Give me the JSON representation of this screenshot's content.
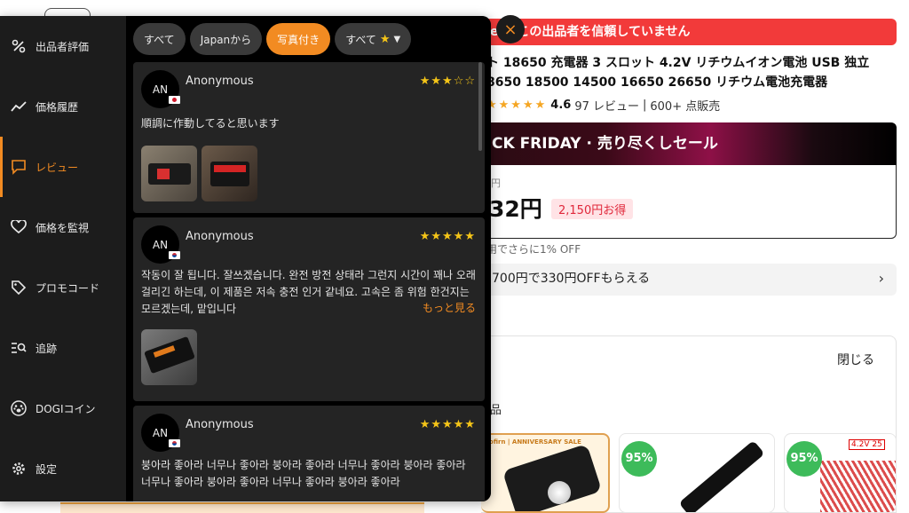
{
  "background": {
    "trust_banner": "erはこの出品者を信頼していません",
    "title_line1": "ト 18650 充電器 3 スロット 4.2V リチウムイオン電池 USB 独立",
    "title_line2": "8650 18500 14500 16650 26650 リチウム電池充電器",
    "rating_score": "4.6",
    "rating_reviews": "97 レビュー",
    "rating_sold": "600+ 点販売",
    "rating_separator": "|",
    "stars_display": "★★★★★",
    "sale_banner": "CK FRIDAY · 売り尽くしセール",
    "old_price_fragment": "円",
    "price_now": "32円",
    "price_save": "2,150円お得",
    "discount_note": "用でさらに1% OFF",
    "coupon_text": "700円で330円OFFもらえる",
    "coupon_chevron": "›",
    "close_label": "閉じる",
    "section_label": "品",
    "card1_tag": "Sofirn | ANNIVERSARY SALE",
    "card2_badge": "95%",
    "card3_badge": "95%",
    "card3_tag": "4.2V 25"
  },
  "extension": {
    "close_icon": "×",
    "sidebar": [
      {
        "label": "出品者評価",
        "icon": "percent-icon"
      },
      {
        "label": "価格履歴",
        "icon": "trend-line-icon"
      },
      {
        "label": "レビュー",
        "icon": "comment-icon",
        "active": true
      },
      {
        "label": "価格を監視",
        "icon": "heart-icon"
      },
      {
        "label": "プロモコード",
        "icon": "tag-icon"
      },
      {
        "label": "追跡",
        "icon": "track-icon"
      },
      {
        "label": "DOGIコイン",
        "icon": "paw-icon"
      },
      {
        "label": "設定",
        "icon": "gear-icon"
      }
    ],
    "filters": {
      "all": "すべて",
      "from_japan": "Japanから",
      "with_photos": "写真付き",
      "stars_all": "すべて",
      "star_icon": "★",
      "caret": "▼"
    },
    "reviews": [
      {
        "avatar": "AN",
        "name": "Anonymous",
        "stars": 3,
        "star_string_on": "★★★",
        "star_string_off": "☆☆",
        "text": "順調に作動してると思います",
        "flag": "jp"
      },
      {
        "avatar": "AN",
        "name": "Anonymous",
        "stars": 5,
        "star_string_on": "★★★★★",
        "star_string_off": "",
        "text": "작동이 잘 됩니다. 잘쓰겠습니다. 완전 방전 상태라 그런지 시간이 꽤나 오래 걸리긴 하는데, 이 제품은 저속 충전 인거 같네요. 고속은 좀 위험 한건지는 모르겠는데, 맡입니다",
        "more": "もっと見る",
        "flag": "kr"
      },
      {
        "avatar": "AN",
        "name": "Anonymous",
        "stars": 5,
        "star_string_on": "★★★★★",
        "star_string_off": "",
        "text": "붕아라 좋아라 너무나 좋아라 붕아라 좋아라 너무나 좋아라 붕아라 좋아라 너무나 좋아라 붕아라 좋아라 너무나 좋아라 붕아라 좋아라",
        "flag": "kr"
      }
    ]
  },
  "colors": {
    "accent": "#f28b22",
    "panel": "#1c1c1c",
    "card": "#242424",
    "star": "#f5c518",
    "banner_red": "#f23a3a"
  }
}
